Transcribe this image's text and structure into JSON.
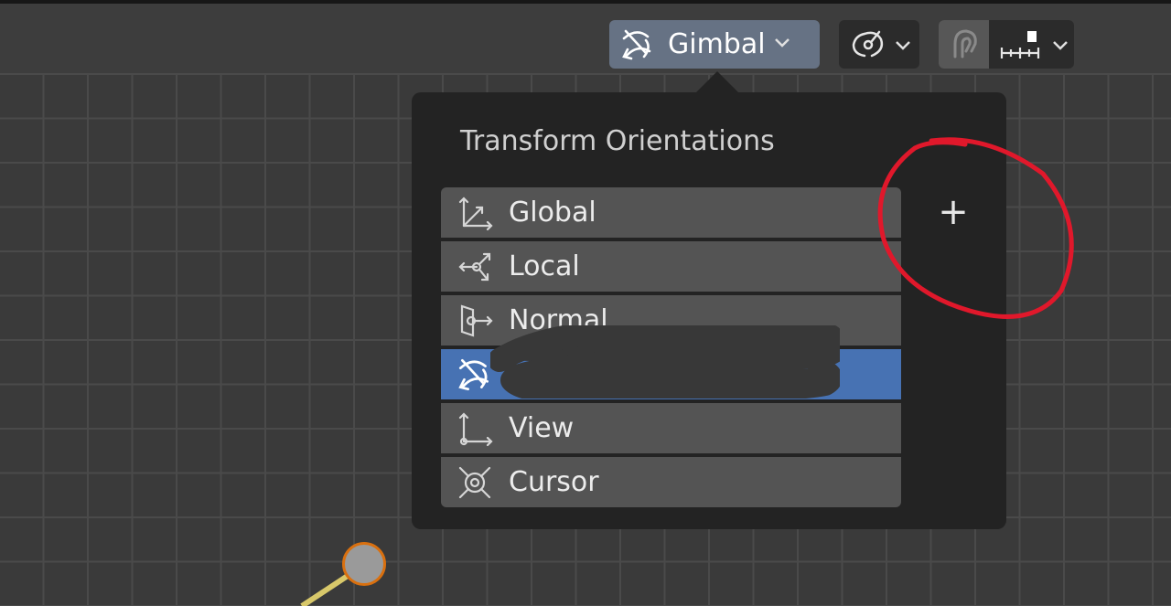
{
  "header": {
    "orientation_selector": {
      "label": "Gimbal",
      "icon": "gimbal-icon"
    },
    "pivot_selector": {
      "icon": "pivot-icon"
    },
    "snap": {
      "toggle_icon": "magnet-icon",
      "element_icon": "snap-increment-icon"
    }
  },
  "popup": {
    "title": "Transform Orientations",
    "items": [
      {
        "label": "Global",
        "icon": "global-axes-icon",
        "selected": false
      },
      {
        "label": "Local",
        "icon": "local-axes-icon",
        "selected": false
      },
      {
        "label": "Normal",
        "icon": "normal-icon",
        "selected": false
      },
      {
        "label": "",
        "icon": "gimbal-icon",
        "selected": true
      },
      {
        "label": "View",
        "icon": "view-axes-icon",
        "selected": false
      },
      {
        "label": "Cursor",
        "icon": "cursor-icon",
        "selected": false
      }
    ],
    "add_button": {
      "label": "+",
      "icon": "plus-icon"
    }
  },
  "colors": {
    "selected": "#4772b3",
    "header_active_button": "#667284",
    "annotation": "#e0182b",
    "origin_outline": "#d9700f"
  }
}
